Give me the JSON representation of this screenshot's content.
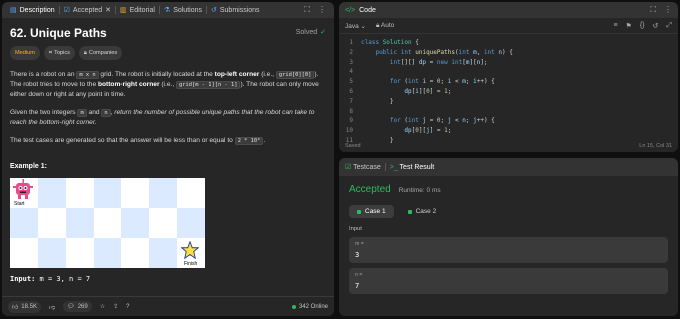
{
  "tabs": [
    {
      "label": "Description",
      "icon": "document-icon"
    },
    {
      "label": "Accepted",
      "icon": "check-icon"
    },
    {
      "label": "Editorial",
      "icon": "book-icon"
    },
    {
      "label": "Solutions",
      "icon": "flask-icon"
    },
    {
      "label": "Submissions",
      "icon": "history-icon"
    }
  ],
  "problem": {
    "title": "62. Unique Paths",
    "status": "Solved",
    "difficulty": "Medium",
    "topics_label": "Topics",
    "companies_label": "Companies",
    "p1": {
      "a": "There is a robot on an ",
      "grid_code": "m x n",
      "b": " grid. The robot is initially located at the ",
      "top_left": "top-left corner",
      "c": " (i.e., ",
      "code1": "grid[0][0]",
      "d": "). The robot tries to move to the ",
      "bottom_right": "bottom-right corner",
      "e": " (i.e., ",
      "code2": "grid[m - 1][n - 1]",
      "f": "). The robot can only move either down or right at any point in time."
    },
    "p2": {
      "a": "Given the two integers ",
      "m": "m",
      "b": " and ",
      "n": "n",
      "c": ", return the number of possible unique paths that the robot can take to reach the bottom-right corner."
    },
    "p3": {
      "a": "The test cases are generated so that the answer will be less than or equal to ",
      "code": "2 * 10⁹",
      "b": "."
    },
    "example_title": "Example 1:",
    "start_label": "Start",
    "finish_label": "Finish",
    "input_label": "Input:",
    "input_value": " m = 3, n = 7"
  },
  "bottom_bar": {
    "likes": "18.5K",
    "comments": "269",
    "online": "342 Online"
  },
  "code": {
    "header": "Code",
    "language": "Java",
    "mode": "Auto",
    "status_left": "Saved",
    "status_right": "Ln 15, Col 31",
    "line_numbers": [
      "1",
      "2",
      "3",
      "4",
      "5",
      "6",
      "7",
      "8",
      "9",
      "10",
      "11"
    ]
  },
  "test": {
    "tab1": "Testcase",
    "tab2": "Test Result",
    "result": "Accepted",
    "runtime": "Runtime: 0 ms",
    "case1": "Case 1",
    "case2": "Case 2",
    "input_label": "Input",
    "m_key": "m =",
    "m_val": "3",
    "n_key": "n =",
    "n_val": "7"
  },
  "colors": {
    "accent_green": "#2cbb5d",
    "medium": "#ffb800",
    "grid_light": "#dbeafe",
    "grid_white": "#ffffff"
  }
}
